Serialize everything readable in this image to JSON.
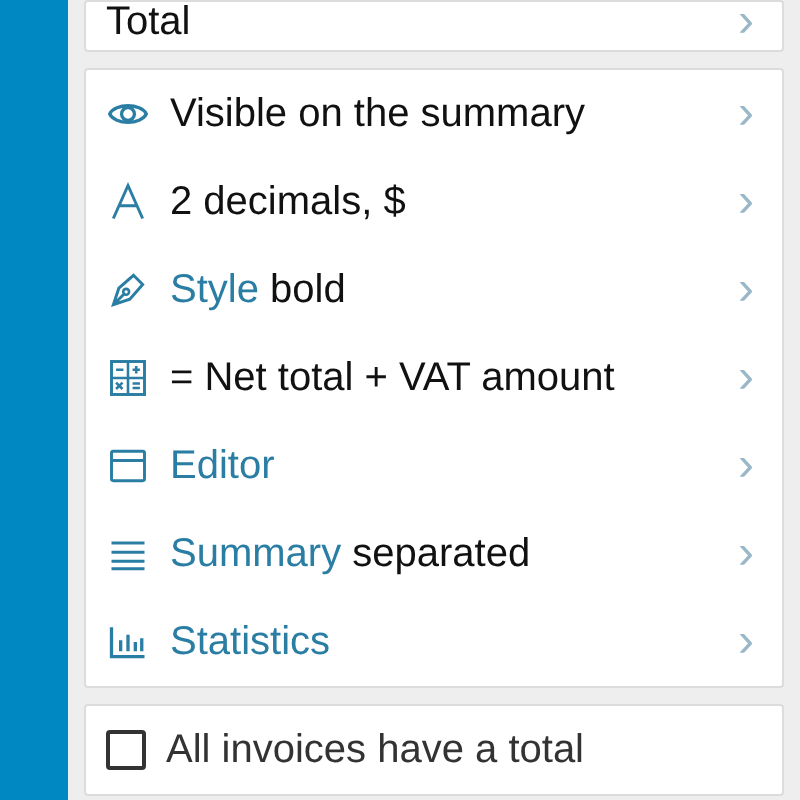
{
  "top_row": {
    "label": "Total",
    "chevron": "›"
  },
  "settings": [
    {
      "kind": "eye",
      "value": "Visible on the summary",
      "chevron": "›"
    },
    {
      "kind": "font",
      "value": "2 decimals, $",
      "chevron": "›"
    },
    {
      "kind": "pen",
      "label": "Style",
      "value": "bold",
      "chevron": "›"
    },
    {
      "kind": "calculator",
      "value": "= Net total + VAT amount",
      "chevron": "›"
    },
    {
      "kind": "window",
      "label": "Editor",
      "chevron": "›"
    },
    {
      "kind": "lines",
      "label": "Summary",
      "value": "separated",
      "chevron": "›"
    },
    {
      "kind": "chart",
      "label": "Statistics",
      "chevron": "›"
    }
  ],
  "option": {
    "label": "All invoices have a total",
    "checked": false
  }
}
